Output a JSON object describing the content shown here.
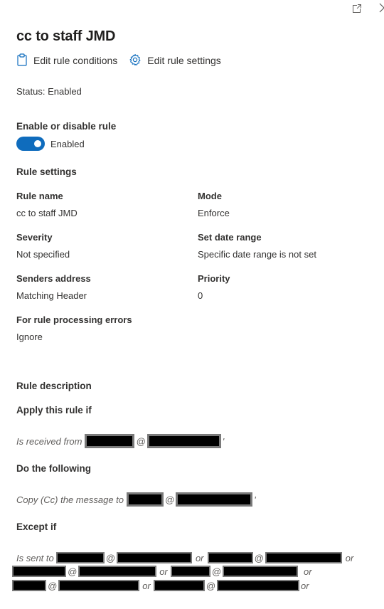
{
  "panel": {
    "title": "cc to staff JMD",
    "popout_icon": "popout-icon",
    "close_icon": "chevron-right-icon"
  },
  "actions": {
    "edit_conditions": {
      "label": "Edit rule conditions",
      "icon": "clipboard-icon"
    },
    "edit_settings": {
      "label": "Edit rule settings",
      "icon": "gear-icon"
    }
  },
  "status": "Status: Enabled",
  "enable": {
    "heading": "Enable or disable rule",
    "state": "Enabled",
    "on": true,
    "accent": "#0f6cbd"
  },
  "rule_settings": {
    "heading": "Rule settings",
    "rule_name": {
      "label": "Rule name",
      "value": "cc to staff JMD"
    },
    "mode": {
      "label": "Mode",
      "value": "Enforce"
    },
    "severity": {
      "label": "Severity",
      "value": "Not specified"
    },
    "date_range": {
      "label": "Set date range",
      "value": "Specific date range is not set"
    },
    "senders": {
      "label": "Senders address",
      "value": "Matching Header"
    },
    "priority": {
      "label": "Priority",
      "value": "0"
    },
    "errors": {
      "label": "For rule processing errors",
      "value": "Ignore"
    }
  },
  "description": {
    "heading": "Rule description",
    "apply_heading": "Apply this rule if",
    "apply_text": "Is received from",
    "do_heading": "Do the following",
    "do_text": "Copy (Cc) the message to",
    "except_heading": "Except if",
    "except_text": "Is sent to",
    "at": "@",
    "or": "or",
    "quote": "'"
  }
}
